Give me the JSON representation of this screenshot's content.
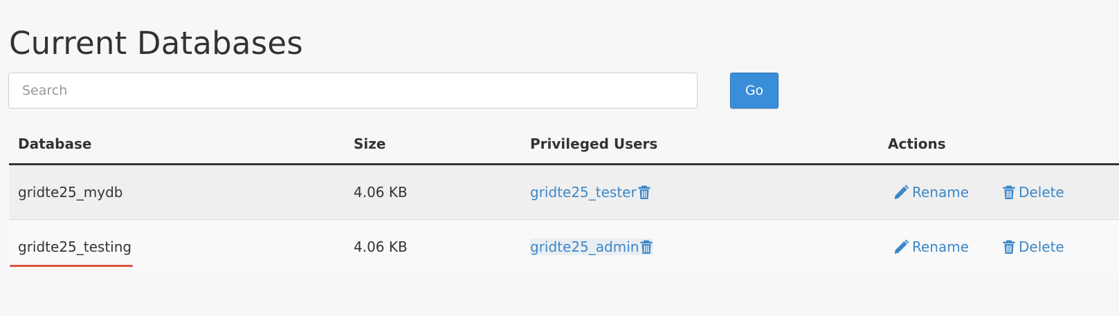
{
  "page": {
    "title": "Current Databases"
  },
  "search": {
    "placeholder": "Search",
    "value": "",
    "go_label": "Go"
  },
  "table": {
    "headers": {
      "database": "Database",
      "size": "Size",
      "privileged_users": "Privileged Users",
      "actions": "Actions"
    },
    "rows": [
      {
        "database": "gridte25_mydb",
        "size": "4.06 KB",
        "user": "gridte25_tester",
        "rename_label": "Rename",
        "delete_label": "Delete"
      },
      {
        "database": "gridte25_testing",
        "size": "4.06 KB",
        "user": "gridte25_admin",
        "rename_label": "Rename",
        "delete_label": "Delete"
      }
    ]
  },
  "icons": {
    "remove_user": "trash-icon",
    "rename": "pencil-icon",
    "delete": "trash-icon"
  },
  "colors": {
    "accent": "#3a8dd8",
    "link": "#3c87c8",
    "annotation_underline": "#d9533c"
  }
}
